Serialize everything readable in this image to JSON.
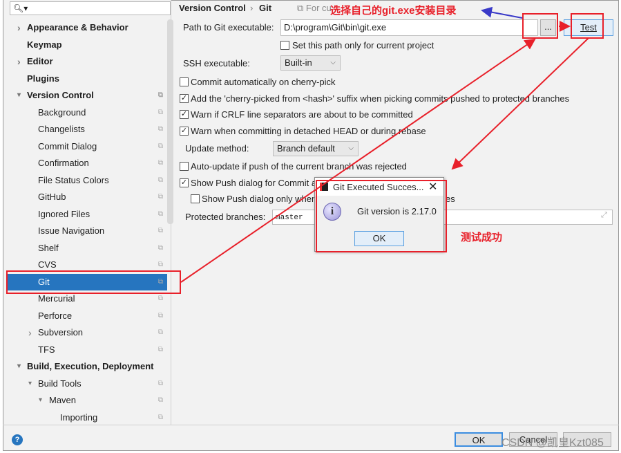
{
  "sidebar": {
    "search_placeholder": "",
    "items": [
      {
        "label": "Appearance & Behavior",
        "level": 0,
        "arrow": "right",
        "bold": true
      },
      {
        "label": "Keymap",
        "level": 0,
        "bold": true
      },
      {
        "label": "Editor",
        "level": 0,
        "arrow": "right",
        "bold": true
      },
      {
        "label": "Plugins",
        "level": 0,
        "bold": true
      },
      {
        "label": "Version Control",
        "level": 0,
        "arrow": "down",
        "bold": true,
        "copy": true
      },
      {
        "label": "Background",
        "level": 1,
        "copy": true
      },
      {
        "label": "Changelists",
        "level": 1,
        "copy": true
      },
      {
        "label": "Commit Dialog",
        "level": 1,
        "copy": true
      },
      {
        "label": "Confirmation",
        "level": 1,
        "copy": true
      },
      {
        "label": "File Status Colors",
        "level": 1,
        "copy": true
      },
      {
        "label": "GitHub",
        "level": 1,
        "copy": true
      },
      {
        "label": "Ignored Files",
        "level": 1,
        "copy": true
      },
      {
        "label": "Issue Navigation",
        "level": 1,
        "copy": true
      },
      {
        "label": "Shelf",
        "level": 1,
        "copy": true
      },
      {
        "label": "CVS",
        "level": 1,
        "copy": true
      },
      {
        "label": "Git",
        "level": 1,
        "copy": true,
        "selected": true
      },
      {
        "label": "Mercurial",
        "level": 1,
        "copy": true
      },
      {
        "label": "Perforce",
        "level": 1,
        "copy": true
      },
      {
        "label": "Subversion",
        "level": 1,
        "arrow": "right",
        "copy": true
      },
      {
        "label": "TFS",
        "level": 1,
        "copy": true
      },
      {
        "label": "Build, Execution, Deployment",
        "level": 0,
        "arrow": "down",
        "bold": true
      },
      {
        "label": "Build Tools",
        "level": 1,
        "arrow": "down",
        "copy": true
      },
      {
        "label": "Maven",
        "level": 2,
        "arrow": "down",
        "copy": true
      },
      {
        "label": "Importing",
        "level": 3,
        "copy": true
      }
    ]
  },
  "header": {
    "crumb1": "Version Control",
    "sep": "›",
    "crumb2": "Git",
    "scope": "For cu"
  },
  "settings": {
    "path_label": "Path to Git executable:",
    "path_value": "D:\\program\\Git\\bin\\git.exe",
    "browse_label": "...",
    "test_label": "Test",
    "set_path_only": {
      "label": "Set this path only for current project",
      "checked": false
    },
    "ssh_label": "SSH executable:",
    "ssh_value": "Built-in",
    "checks": [
      {
        "label": "Commit automatically on cherry-pick",
        "checked": false
      },
      {
        "label": "Add the 'cherry-picked from <hash>' suffix when picking commits pushed to protected branches",
        "checked": true
      },
      {
        "label": "Warn if CRLF line separators are about to be committed",
        "checked": true
      },
      {
        "label": "Warn when committing in detached HEAD or during rebase",
        "checked": true
      }
    ],
    "update_label": "Update method:",
    "update_value": "Branch default",
    "auto_update": {
      "label": "Auto-update if push of the current branch was rejected",
      "checked": false
    },
    "show_push": {
      "label": "Show Push dialog for Commit a",
      "checked": true
    },
    "show_push_only": {
      "label": "Show Push dialog only when",
      "tail": "es",
      "checked": false
    },
    "protected_label": "Protected branches:",
    "protected_value": "master"
  },
  "dialog": {
    "title": "Git Executed Succes...",
    "message": "Git version is 2.17.0",
    "ok": "OK",
    "icon": "info-icon"
  },
  "footer": {
    "ok": "OK",
    "cancel": "Cancel",
    "help": "?"
  },
  "annotations": {
    "choose_dir": "选择自己的git.exe安装目录",
    "success": "测试成功",
    "watermark": "CSDN @凯皇Kzt085",
    "color": "#e8202a",
    "blue": "#3a3ac8"
  }
}
